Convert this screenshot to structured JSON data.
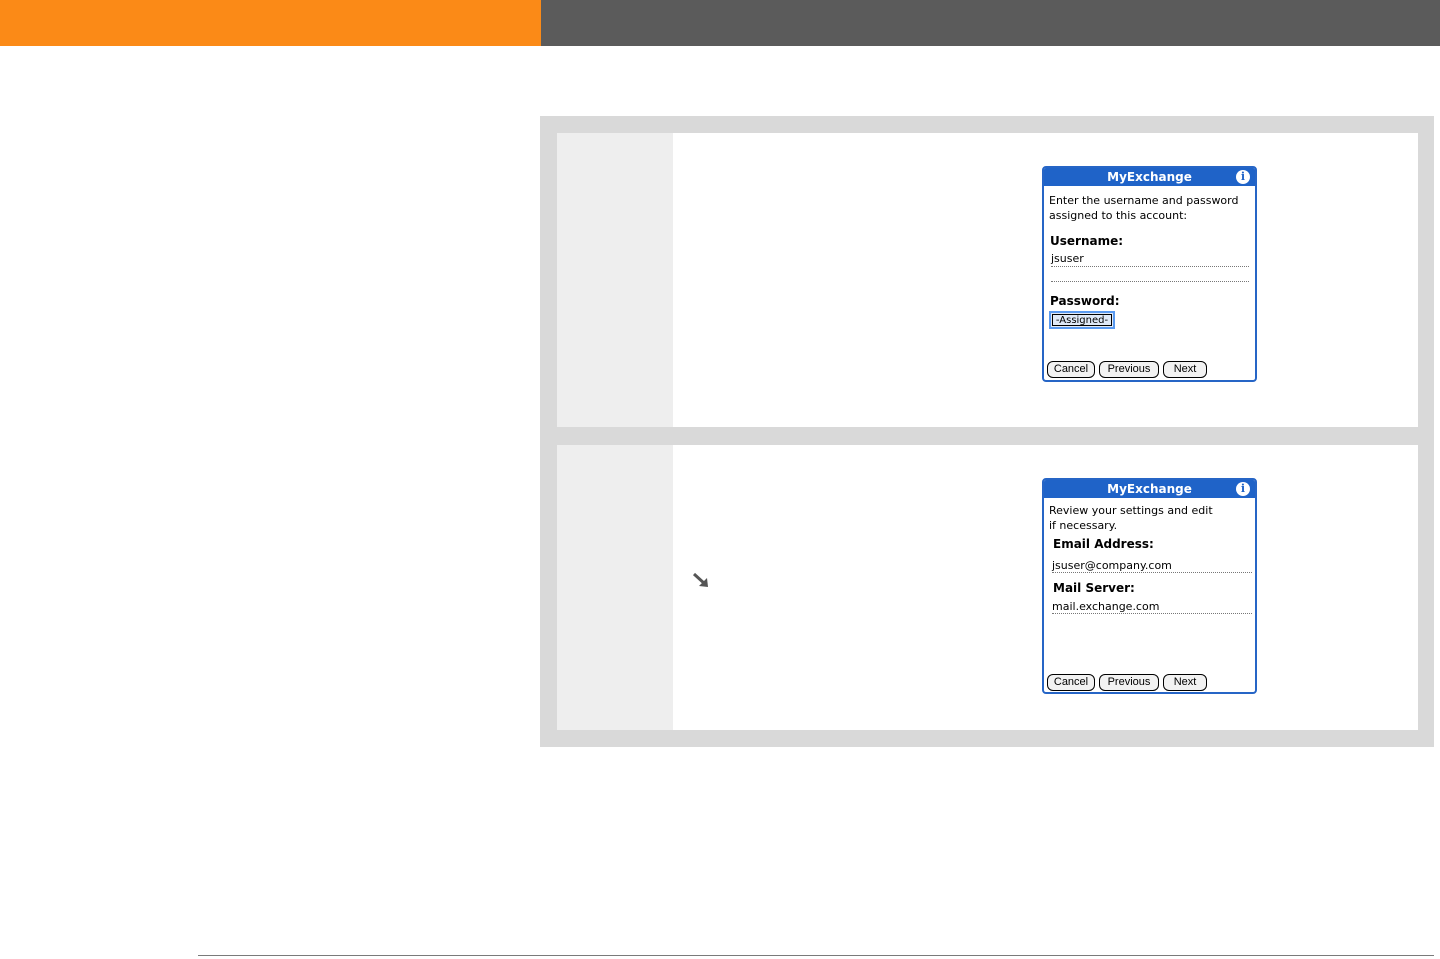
{
  "colors": {
    "header_orange": "#fb8a17",
    "header_gray": "#5b5b5b",
    "palm_blue": "#1f63c8",
    "panel_gray": "#d9d9d9"
  },
  "steps": [
    {
      "dialog": {
        "title": "MyExchange",
        "info_icon": "i",
        "instructions": [
          "Enter the username and password",
          "assigned to this account:"
        ],
        "username_label": "Username:",
        "username_value": "jsuser",
        "password_label": "Password:",
        "password_value": "-Assigned-",
        "buttons": {
          "cancel": "Cancel",
          "previous": "Previous",
          "next": "Next"
        }
      }
    },
    {
      "tip_icon": "arrow-down-right-icon",
      "dialog": {
        "title": "MyExchange",
        "info_icon": "i",
        "instructions": [
          "Review your settings and edit",
          "if necessary."
        ],
        "email_label": "Email Address:",
        "email_value": "jsuser@company.com",
        "server_label": "Mail Server:",
        "server_value": "mail.exchange.com",
        "buttons": {
          "cancel": "Cancel",
          "previous": "Previous",
          "next": "Next"
        }
      }
    }
  ]
}
